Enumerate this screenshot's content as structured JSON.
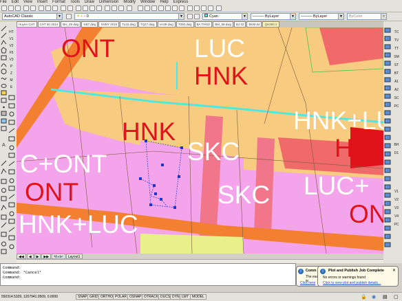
{
  "menu": [
    "File",
    "Edit",
    "View",
    "Insert",
    "Format",
    "Tools",
    "Draw",
    "Dimension",
    "Modify",
    "Window",
    "Help",
    "Express"
  ],
  "toolbar": {
    "workspace": "AutoCAD Classic",
    "color": "Cyan",
    "linetype1": "ByLayer",
    "linetype2": "ByLayer",
    "plotstyle": "ByColor",
    "layer_num": "0"
  },
  "file_tabs": [
    "Huyen CHT",
    "CHT 50 2014",
    "BH_49 dwg",
    "KB7.dwg",
    "XNNY 2015",
    "Tu15.dwg",
    "TQ27 dwg",
    "VA39 dwg",
    "T000.dwg",
    "BA THNO",
    "BM_58.dwg",
    "BJ 02",
    "BKM 64",
    "QH300 2"
  ],
  "left_tools": [
    "HT",
    "V1",
    "V2",
    "F5",
    "V3",
    "P",
    "Z",
    "M",
    "E"
  ],
  "right_tools": [
    "TC",
    "TV",
    "TT",
    "SM",
    "ST",
    "BT",
    "A1",
    "A2",
    "SC",
    "PC",
    "BH",
    "D1",
    "V1",
    "V2",
    "V3",
    "V4",
    "PC"
  ],
  "map_labels": [
    {
      "text": "ONT",
      "color": "red"
    },
    {
      "text": "LUC",
      "color": "white"
    },
    {
      "text": "HNK",
      "color": "red"
    },
    {
      "text": "HNK",
      "color": "red"
    },
    {
      "text": "SKC",
      "color": "white"
    },
    {
      "text": "HNK+LUC",
      "color": "white"
    },
    {
      "text": "HNK",
      "color": "red"
    },
    {
      "text": "C+ONT",
      "color": "white"
    },
    {
      "text": "ONT",
      "color": "red"
    },
    {
      "text": "SKC",
      "color": "white"
    },
    {
      "text": "LUC+",
      "color": "white"
    },
    {
      "text": "ONT",
      "color": "red"
    },
    {
      "text": "HNK+LUC",
      "color": "white"
    }
  ],
  "layout_tabs": [
    "Model",
    "Layout1"
  ],
  "command": {
    "lines": [
      "Command:",
      "Command: *Cancel*",
      "Command:"
    ]
  },
  "status": {
    "coords": "550314.5329, 1207941.9509, 0.0000",
    "buttons": [
      "SNAP",
      "GRID",
      "ORTHO",
      "POLAR",
      "OSNAP",
      "OTRACK",
      "DUCS",
      "DYN",
      "LWT",
      "MODEL"
    ]
  },
  "notification1": {
    "title": "Comm",
    "line1": "The easy w",
    "line2": "Click here"
  },
  "notification2": {
    "title": "Plot and Publish Job Complete",
    "line1": "No errors or warnings found",
    "link": "Click to view plot and publish details..."
  },
  "colors": {
    "pink": "#f4a4ea",
    "tan": "#f8cc80",
    "orange": "#f28030",
    "red": "#e0121a",
    "cyan": "#4ee8e0"
  }
}
